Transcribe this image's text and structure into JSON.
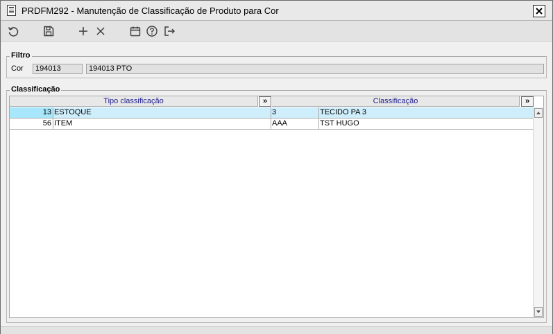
{
  "window": {
    "title": "PRDFM292 - Manutenção de Classificação de Produto para Cor"
  },
  "toolbar": {
    "buttons": [
      {
        "name": "refresh-icon"
      },
      {
        "name": "save-icon"
      },
      {
        "name": "add-icon"
      },
      {
        "name": "delete-icon"
      },
      {
        "name": "calendar-icon"
      },
      {
        "name": "help-icon"
      },
      {
        "name": "exit-icon"
      }
    ]
  },
  "filter": {
    "legend": "Filtro",
    "cor_label": "Cor",
    "cor_code": "194013",
    "cor_description": "194013 PTO"
  },
  "classification": {
    "legend": "Classificação",
    "columns": [
      "Tipo classificação",
      "Classificação"
    ],
    "expand_label": "»",
    "rows": [
      {
        "tipo_code": "13",
        "tipo_desc": "ESTOQUE",
        "class_code": "3",
        "class_desc": "TECIDO PA 3",
        "selected": true
      },
      {
        "tipo_code": "56",
        "tipo_desc": "ITEM",
        "class_code": "AAA",
        "class_desc": "TST HUGO",
        "selected": false
      }
    ]
  }
}
